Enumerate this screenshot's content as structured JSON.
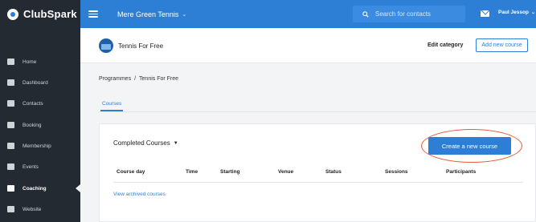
{
  "brand": {
    "name": "ClubSpark"
  },
  "topbar": {
    "venue": "Mere Green Tennis",
    "search_placeholder": "Search for contacts",
    "user_name": "Paul Jessop"
  },
  "sidebar": {
    "items": [
      {
        "label": "Home",
        "icon": "home-icon"
      },
      {
        "label": "Dashboard",
        "icon": "dashboard-icon"
      },
      {
        "label": "Contacts",
        "icon": "contacts-icon"
      },
      {
        "label": "Booking",
        "icon": "booking-icon"
      },
      {
        "label": "Membership",
        "icon": "membership-icon"
      },
      {
        "label": "Events",
        "icon": "events-icon"
      },
      {
        "label": "Coaching",
        "icon": "coaching-icon",
        "active": true
      },
      {
        "label": "Website",
        "icon": "website-icon"
      }
    ]
  },
  "page": {
    "title": "Tennis For Free",
    "edit_category": "Edit category",
    "add_new_course": "Add new course",
    "breadcrumb": [
      "Programmes",
      "/",
      "Tennis For Free"
    ],
    "tab": "Courses"
  },
  "courses": {
    "filter": "Completed Courses",
    "create_button": "Create a new course",
    "columns": [
      "Course day",
      "Time",
      "Starting",
      "Venue",
      "Status",
      "Sessions",
      "Participants"
    ],
    "archived_link": "View archived courses"
  },
  "colors": {
    "topbar": "#2d7fd6",
    "sidebar": "#232a31",
    "accent": "#2d7fd6",
    "highlight_circle": "#e85a3a"
  }
}
